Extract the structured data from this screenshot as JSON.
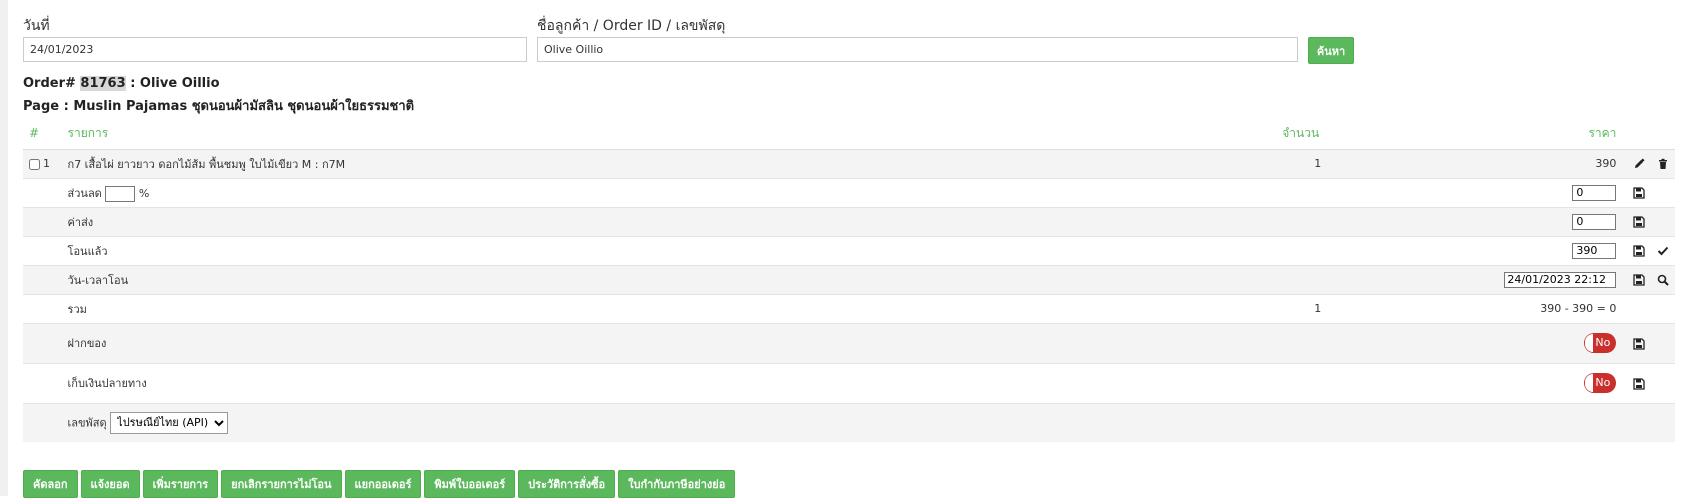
{
  "search": {
    "date_label": "วันที่",
    "date_value": "24/01/2023",
    "query_label": "ชื่อลูกค้า / Order ID / เลขพัสดุ",
    "query_value": "Olive Oillio",
    "search_button": "ค้นหา"
  },
  "order": {
    "prefix": "Order#",
    "id": "81763",
    "customer": ": Olive Oillio",
    "page_line": "Page : Muslin Pajamas ชุดนอนผ้ามัสลิน ชุดนอนผ้าใยธรรมชาติ"
  },
  "table": {
    "headers": {
      "num": "#",
      "item": "รายการ",
      "qty": "จำนวน",
      "price": "ราคา"
    },
    "item_row": {
      "num": "1",
      "name": "ก7 เสื้อไผ่ ยาวยาว ดอกไม้ส้ม พื้นชมพู ใบไม้เขียว M : ก7M",
      "qty": "1",
      "price": "390"
    },
    "discount": {
      "label": "ส่วนลด",
      "percent_value": "",
      "percent_sign": "%",
      "value": "0"
    },
    "shipping": {
      "label": "ค่าส่ง",
      "value": "0"
    },
    "transferred": {
      "label": "โอนแล้ว",
      "value": "390"
    },
    "transfer_time": {
      "label": "วัน-เวลาโอน",
      "value": "24/01/2023 22:12"
    },
    "total": {
      "label": "รวม",
      "qty": "1",
      "value": "390 - 390 = 0"
    },
    "deposit": {
      "label": "ฝากของ",
      "toggle": "No"
    },
    "cod": {
      "label": "เก็บเงินปลายทาง",
      "toggle": "No"
    },
    "tracking": {
      "label": "เลขพัสดุ",
      "selected": "ไปรษณีย์ไทย (API)"
    }
  },
  "actions": [
    "คัดลอก",
    "แจ้งยอด",
    "เพิ่มรายการ",
    "ยกเลิกรายการไม่โอน",
    "แยกออเดอร์",
    "พิมพ์ใบออเดอร์",
    "ประวัติการสั่งซื้อ",
    "ใบกำกับภาษีอย่างย่อ"
  ],
  "colors": {
    "accent": "#5cb85c",
    "danger": "#c9302c"
  }
}
